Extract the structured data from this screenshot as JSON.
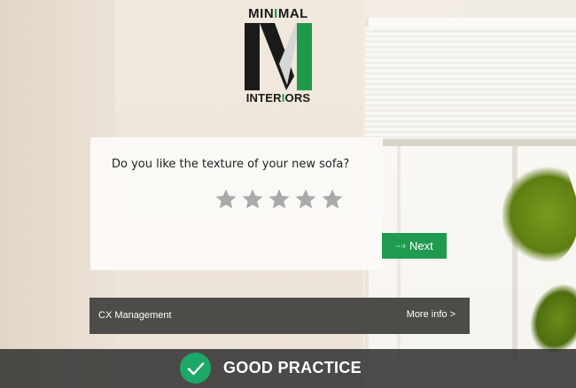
{
  "logo": {
    "top_text_parts": [
      "MIN",
      "I",
      "MAL"
    ],
    "bottom_text_parts": [
      "INTER",
      "I",
      "ORS"
    ],
    "mark_letter": "M",
    "accent_color": "#1e9a4a"
  },
  "survey": {
    "question": "Do you like the texture of your new sofa?",
    "star_count": 5,
    "rating_selected": 0,
    "next_label": "Next",
    "next_icon": "···›",
    "button_color": "#1f9a4e"
  },
  "cx_bar": {
    "title": "CX Management",
    "more_info": "More info >"
  },
  "banner": {
    "label": "GOOD PRACTICE",
    "icon": "check-icon",
    "icon_color": "#1ea868"
  }
}
